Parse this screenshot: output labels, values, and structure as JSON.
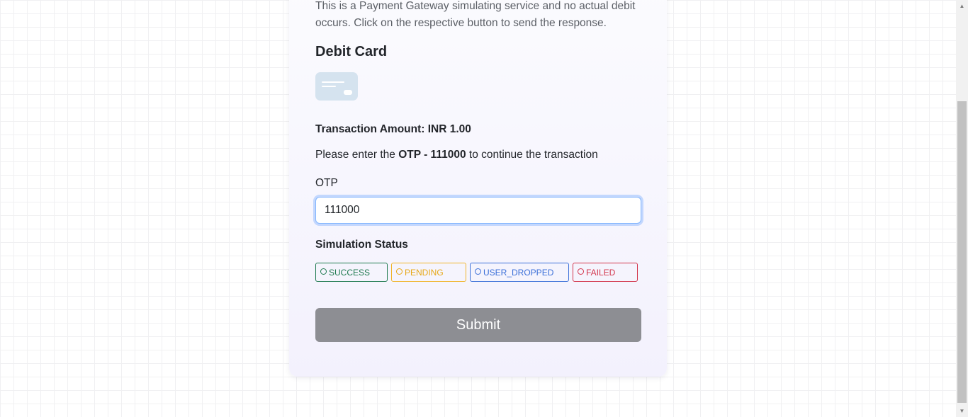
{
  "intro_text": "This is a Payment Gateway simulating service and no actual debit occurs. Click on the respective button to send the response.",
  "card_title": "Debit Card",
  "card_icon": "credit-card-icon",
  "amount": {
    "label": "Transaction Amount: ",
    "value": "INR 1.00"
  },
  "otp_hint": {
    "prefix": "Please enter the ",
    "code": "OTP - 111000",
    "suffix": " to continue the transaction"
  },
  "otp_field": {
    "label": "OTP",
    "value": "111000"
  },
  "simulation": {
    "label": "Simulation Status",
    "options": [
      "SUCCESS",
      "PENDING",
      "USER_DROPPED",
      "FAILED"
    ],
    "colors": {
      "success": "#1e7a4f",
      "pending": "#f0b429",
      "user_dropped": "#3a6fd8",
      "failed": "#d2344a"
    }
  },
  "submit_label": "Submit",
  "colors": {
    "submit_bg": "#8d8e93",
    "input_focus": "#86b7fe"
  }
}
